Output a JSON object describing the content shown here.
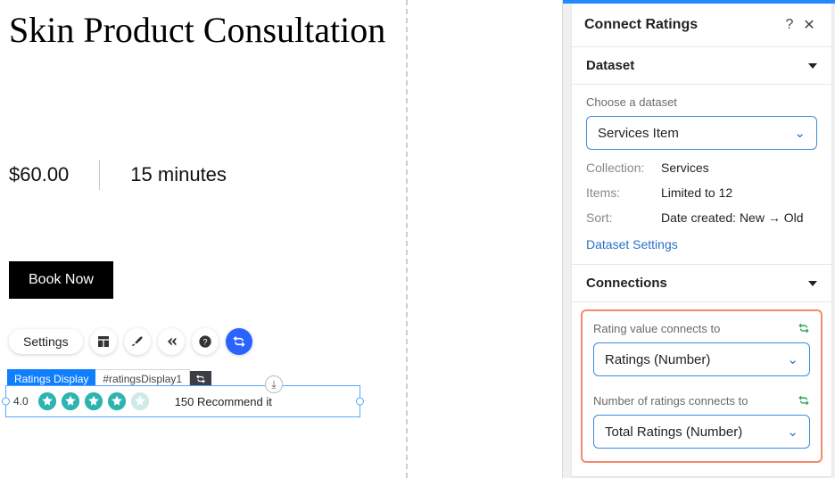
{
  "page": {
    "title": "Skin Product Consultation",
    "price": "$60.00",
    "duration": "15 minutes",
    "book_label": "Book Now"
  },
  "toolbar": {
    "settings_label": "Settings"
  },
  "element_tag": {
    "type": "Ratings Display",
    "id": "#ratingsDisplay1"
  },
  "ratings_widget": {
    "value": "4.0",
    "count": "150",
    "text": "Recommend it",
    "stars_filled": 4,
    "stars_total": 5
  },
  "panel": {
    "title": "Connect Ratings",
    "dataset_section": {
      "heading": "Dataset",
      "choose_label": "Choose a dataset",
      "selected": "Services Item",
      "collection_label": "Collection:",
      "collection_value": "Services",
      "items_label": "Items:",
      "items_value": "Limited to 12",
      "sort_label": "Sort:",
      "sort_value": "Date created: New → Old",
      "settings_link": "Dataset Settings"
    },
    "connections_section": {
      "heading": "Connections",
      "rating_value_label": "Rating value connects to",
      "rating_value_selected": "Ratings (Number)",
      "num_ratings_label": "Number of ratings connects to",
      "num_ratings_selected": "Total Ratings (Number)"
    }
  }
}
